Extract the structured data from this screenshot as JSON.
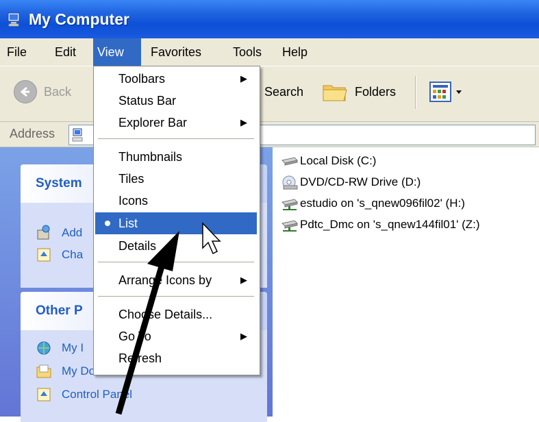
{
  "window": {
    "title": "My Computer",
    "title_icon": "my-computer-icon"
  },
  "menubar": {
    "items": [
      "File",
      "Edit",
      "View",
      "Favorites",
      "Tools",
      "Help"
    ],
    "active": "View"
  },
  "toolbar": {
    "back_label": "Back",
    "search_label": "Search",
    "folders_label": "Folders"
  },
  "addressbar": {
    "label": "Address"
  },
  "view_menu": {
    "items": [
      {
        "label": "Toolbars",
        "submenu": true
      },
      {
        "label": "Status Bar"
      },
      {
        "label": "Explorer Bar",
        "submenu": true
      },
      {
        "label": "Thumbnails"
      },
      {
        "label": "Tiles"
      },
      {
        "label": "Icons"
      },
      {
        "label": "List",
        "selected": true,
        "highlighted": true
      },
      {
        "label": "Details"
      },
      {
        "label": "Arrange Icons by",
        "submenu": true
      },
      {
        "label": "Choose Details..."
      },
      {
        "label": "Go To",
        "submenu": true
      },
      {
        "label": "Refresh"
      }
    ]
  },
  "taskpane": {
    "system_tasks": {
      "heading": "System",
      "links": [
        "Add",
        "Cha"
      ]
    },
    "other_places": {
      "heading": "Other P",
      "links": [
        "My I",
        "My Documents",
        "Control Panel"
      ]
    }
  },
  "drives": [
    {
      "label": "Local Disk (C:)",
      "icon": "hard-disk-icon"
    },
    {
      "label": "DVD/CD-RW Drive (D:)",
      "icon": "dvd-drive-icon"
    },
    {
      "label": "estudio on 's_qnew096fil02' (H:)",
      "icon": "network-drive-icon"
    },
    {
      "label": "Pdtc_Dmc on 's_qnew144fil01' (Z:)",
      "icon": "network-drive-icon"
    }
  ],
  "colors": {
    "titlebar": "#1f63e0",
    "menu_highlight": "#316ac5",
    "chrome": "#ece9d8",
    "taskpane": "#7ba2e7",
    "link": "#215dc6"
  }
}
